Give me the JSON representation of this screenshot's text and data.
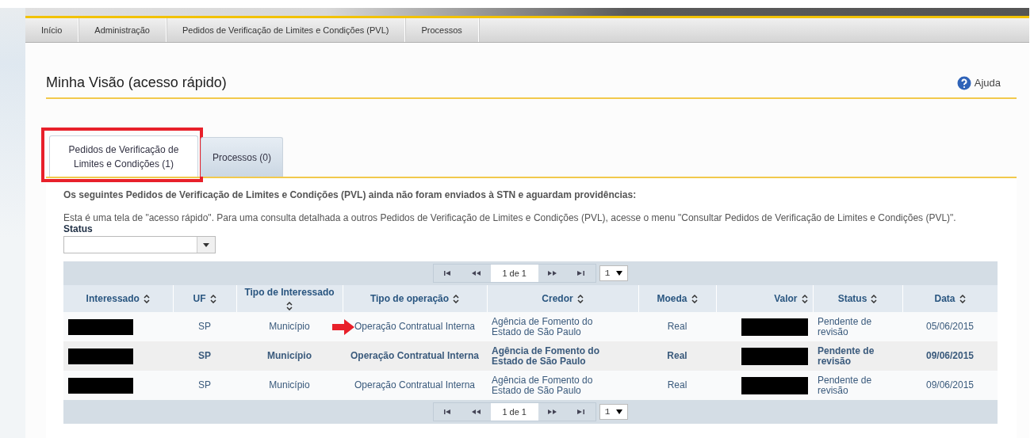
{
  "nav": [
    {
      "label": "Início"
    },
    {
      "label": "Administração"
    },
    {
      "label": "Pedidos de Verificação de Limites e Condições (PVL)"
    },
    {
      "label": "Processos"
    }
  ],
  "title": "Minha Visão (acesso rápido)",
  "help": "Ajuda",
  "tabs": [
    {
      "label": "Pedidos de Verificação de Limites e Condições (1)",
      "selected": true,
      "highlighted": true
    },
    {
      "label": "Processos (0)",
      "selected": false,
      "highlighted": false
    }
  ],
  "intro": "Os seguintes Pedidos de Verificação de Limites e Condições (PVL) ainda não foram enviados à STN e aguardam providências:",
  "note": "Esta é uma tela de \"acesso rápido\". Para uma consulta detalhada a outros Pedidos de Verificação de Limites e Condições (PVL), acesse o menu \"Consultar Pedidos de Verificação de Limites e Condições (PVL)\".",
  "status_filter": {
    "label": "Status"
  },
  "pager_top": {
    "page": "1 de 1",
    "rows": "1"
  },
  "pager_bottom": {
    "page": "1 de 1",
    "rows": "1"
  },
  "columns": [
    {
      "label": "Interessado"
    },
    {
      "label": "UF"
    },
    {
      "label": "Tipo de Interessado"
    },
    {
      "label": "Tipo de operação"
    },
    {
      "label": "Credor"
    },
    {
      "label": "Moeda"
    },
    {
      "label": "Valor"
    },
    {
      "label": "Status"
    },
    {
      "label": "Data"
    }
  ],
  "rows": [
    {
      "selected": false,
      "pointed": true,
      "interessado_redacted": true,
      "uf": "SP",
      "tipo_interessado": "Município",
      "tipo_operacao": "Operação Contratual Interna",
      "credor": "Agência de Fomento do Estado de São Paulo",
      "moeda": "Real",
      "valor_redacted": true,
      "status": "Pendente de revisão",
      "data": "05/06/2015"
    },
    {
      "selected": true,
      "pointed": false,
      "interessado_redacted": true,
      "uf": "SP",
      "tipo_interessado": "Município",
      "tipo_operacao": "Operação Contratual Interna",
      "credor": "Agência de Fomento do Estado de São Paulo",
      "moeda": "Real",
      "valor_redacted": true,
      "status": "Pendente de revisão",
      "data": "09/06/2015"
    },
    {
      "selected": false,
      "pointed": false,
      "interessado_redacted": true,
      "uf": "SP",
      "tipo_interessado": "Município",
      "tipo_operacao": "Operação Contratual Interna",
      "credor": "Agência de Fomento do Estado de São Paulo",
      "moeda": "Real",
      "valor_redacted": true,
      "status": "Pendente de revisão",
      "data": "09/06/2015"
    }
  ]
}
